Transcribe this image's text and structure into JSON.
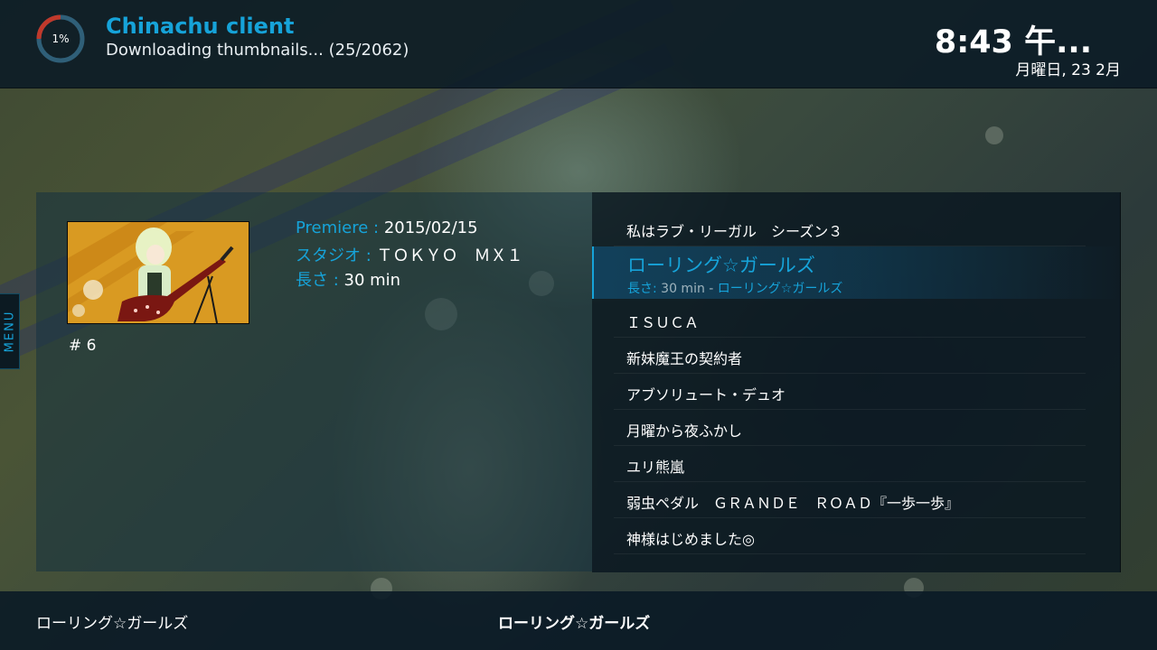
{
  "header": {
    "progress_percent": 1,
    "progress_label": "1%",
    "app_title": "Chinachu client",
    "status": "Downloading thumbnails... (25/2062)",
    "clock": "8:43 午...",
    "date": "月曜日, 23 2月"
  },
  "menu_tab": {
    "label": "MENU"
  },
  "details": {
    "episode": "# 6",
    "premiere_label": "Premiere : ",
    "premiere_value": "2015/02/15",
    "studio_label": "スタジオ : ",
    "studio_value": "ＴＯＫＹＯ　ＭＸ１",
    "length_label": "長さ : ",
    "length_value": "30 min"
  },
  "list": {
    "items_before": [
      {
        "label": "私はラブ・リーガル　シーズン３"
      }
    ],
    "selected": {
      "title": "ローリング☆ガールズ",
      "sub_label": "長さ: ",
      "sub_value": "30 min - ",
      "sub_title": "ローリング☆ガールズ"
    },
    "items_after": [
      {
        "label": "ＩＳＵＣＡ"
      },
      {
        "label": "新妹魔王の契約者"
      },
      {
        "label": "アブソリュート・デュオ"
      },
      {
        "label": "月曜から夜ふかし"
      },
      {
        "label": "ユリ熊嵐"
      },
      {
        "label": "弱虫ペダル　ＧＲＡＮＤＥ　ＲＯＡＤ『一歩一歩』"
      },
      {
        "label": "神様はじめました◎"
      }
    ]
  },
  "footer": {
    "left": "ローリング☆ガールズ",
    "center": "ローリング☆ガールズ"
  },
  "colors": {
    "accent": "#16a3d9",
    "bar_bg": "#0a1a26",
    "ring_track": "#2f5f78",
    "ring_fill": "#c0392b"
  }
}
